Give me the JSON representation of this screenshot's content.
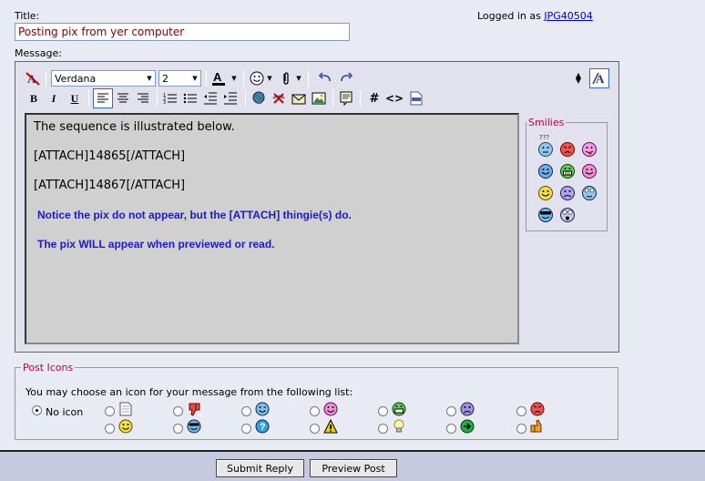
{
  "labels": {
    "title": "Title:",
    "message": "Message:"
  },
  "title_value": "Posting pix from yer computer",
  "login": {
    "prefix": "Logged in as",
    "user": "JPG40504"
  },
  "toolbar": {
    "font": "Verdana",
    "size": "2"
  },
  "message": {
    "lines": [
      "The sequence is illustrated below.",
      "[ATTACH]14865[/ATTACH]",
      "[ATTACH]14867[/ATTACH]"
    ],
    "blue_lines": [
      "Notice the pix do not appear, but the [ATTACH] thingie(s) do.",
      "The pix WILL appear when previewed or read."
    ]
  },
  "smilies": {
    "legend": "Smilies",
    "confused_text": "???"
  },
  "post_icons": {
    "legend": "Post Icons",
    "prompt": "You may choose an icon for your message from the following list:",
    "no_icon": "No icon",
    "selected": "no_icon"
  },
  "buttons": {
    "submit": "Submit Reply",
    "preview": "Preview Post"
  },
  "colors": {
    "link": "#0000cc",
    "legend": "#c00040",
    "blue_text": "#1a1ad0",
    "title_text": "#800000"
  }
}
